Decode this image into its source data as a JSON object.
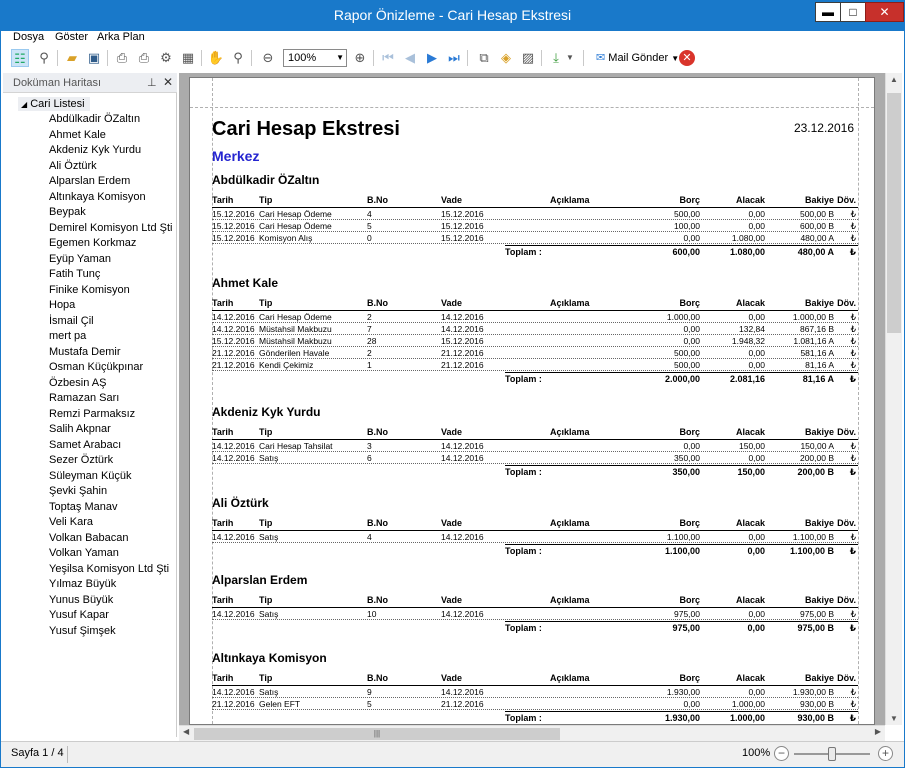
{
  "window": {
    "title": "Rapor Önizleme - Cari Hesap Ekstresi"
  },
  "menu": [
    "Dosya",
    "Göster",
    "Arka Plan"
  ],
  "toolbar": {
    "zoom_value": "100%",
    "mail_label": "Mail Gönder"
  },
  "sidebar": {
    "title": "Doküman Haritası",
    "root": "Cari Listesi",
    "items": [
      "Abdülkadir ÖZaltın",
      "Ahmet Kale",
      "Akdeniz Kyk Yurdu",
      "Ali Öztürk",
      "Alparslan Erdem",
      "Altınkaya Komisyon",
      "Beypak",
      "Demirel Komisyon Ltd Şti",
      "Egemen Korkmaz",
      "Eyüp Yaman",
      "Fatih Tunç",
      "Finike Komisyon",
      "Hopa",
      "İsmail Çil",
      "mert pa",
      "Mustafa Demir",
      "Osman Küçükpınar",
      "Özbesin AŞ",
      "Ramazan Sarı",
      "Remzi Parmaksız",
      "Salih Akpnar",
      "Samet Arabacı",
      "Sezer Öztürk",
      "Süleyman Küçük",
      "Şevki Şahin",
      "Toptaş Manav",
      "Veli Kara",
      "Volkan Babacan",
      "Volkan Yaman",
      "Yeşilsa Komisyon Ltd Şti",
      "Yılmaz Büyük",
      "Yunus Büyük",
      "Yusuf Kapar",
      "Yusuf Şimşek"
    ]
  },
  "report": {
    "title": "Cari Hesap Ekstresi",
    "date": "23.12.2016",
    "branch": "Merkez",
    "columns": {
      "tarih": "Tarih",
      "tip": "Tip",
      "bno": "B.No",
      "vade": "Vade",
      "aciklama": "Açıklama",
      "borc": "Borç",
      "alacak": "Alacak",
      "bakiye": "Bakiye",
      "dov": "Döv."
    },
    "total_label": "Toplam  :",
    "customers": [
      {
        "name": "Abdülkadir ÖZaltın",
        "rows": [
          [
            "15.12.2016",
            "Cari Hesap Ödeme",
            "4",
            "15.12.2016",
            "",
            "500,00",
            "0,00",
            "500,00 B",
            "₺"
          ],
          [
            "15.12.2016",
            "Cari Hesap Ödeme",
            "5",
            "15.12.2016",
            "",
            "100,00",
            "0,00",
            "600,00 B",
            "₺"
          ],
          [
            "15.12.2016",
            "Komisyon Alış",
            "0",
            "15.12.2016",
            "",
            "0,00",
            "1.080,00",
            "480,00 A",
            "₺"
          ]
        ],
        "total": [
          "600,00",
          "1.080,00",
          "480,00 A",
          "₺"
        ]
      },
      {
        "name": "Ahmet Kale",
        "rows": [
          [
            "14.12.2016",
            "Cari Hesap Ödeme",
            "2",
            "14.12.2016",
            "",
            "1.000,00",
            "0,00",
            "1.000,00 B",
            "₺"
          ],
          [
            "14.12.2016",
            "Müstahsil Makbuzu",
            "7",
            "14.12.2016",
            "",
            "0,00",
            "132,84",
            "867,16 B",
            "₺"
          ],
          [
            "15.12.2016",
            "Müstahsil Makbuzu",
            "28",
            "15.12.2016",
            "",
            "0,00",
            "1.948,32",
            "1.081,16 A",
            "₺"
          ],
          [
            "21.12.2016",
            "Gönderilen Havale",
            "2",
            "21.12.2016",
            "",
            "500,00",
            "0,00",
            "581,16 A",
            "₺"
          ],
          [
            "21.12.2016",
            "Kendi Çekimiz",
            "1",
            "21.12.2016",
            "",
            "500,00",
            "0,00",
            "81,16 A",
            "₺"
          ]
        ],
        "total": [
          "2.000,00",
          "2.081,16",
          "81,16 A",
          "₺"
        ]
      },
      {
        "name": "Akdeniz Kyk Yurdu",
        "rows": [
          [
            "14.12.2016",
            "Cari Hesap Tahsilat",
            "3",
            "14.12.2016",
            "",
            "0,00",
            "150,00",
            "150,00 A",
            "₺"
          ],
          [
            "14.12.2016",
            "Satış",
            "6",
            "14.12.2016",
            "",
            "350,00",
            "0,00",
            "200,00 B",
            "₺"
          ]
        ],
        "total": [
          "350,00",
          "150,00",
          "200,00 B",
          "₺"
        ]
      },
      {
        "name": "Ali Öztürk",
        "rows": [
          [
            "14.12.2016",
            "Satış",
            "4",
            "14.12.2016",
            "",
            "1.100,00",
            "0,00",
            "1.100,00 B",
            "₺"
          ]
        ],
        "total": [
          "1.100,00",
          "0,00",
          "1.100,00 B",
          "₺"
        ]
      },
      {
        "name": "Alparslan Erdem",
        "rows": [
          [
            "14.12.2016",
            "Satış",
            "10",
            "14.12.2016",
            "",
            "975,00",
            "0,00",
            "975,00 B",
            "₺"
          ]
        ],
        "total": [
          "975,00",
          "0,00",
          "975,00 B",
          "₺"
        ]
      },
      {
        "name": "Altınkaya Komisyon",
        "rows": [
          [
            "14.12.2016",
            "Satış",
            "9",
            "14.12.2016",
            "",
            "1.930,00",
            "0,00",
            "1.930,00 B",
            "₺"
          ],
          [
            "21.12.2016",
            "Gelen EFT",
            "5",
            "21.12.2016",
            "",
            "0,00",
            "1.000,00",
            "930,00 B",
            "₺"
          ]
        ],
        "total": [
          "1.930,00",
          "1.000,00",
          "930,00 B",
          "₺"
        ]
      }
    ]
  },
  "status": {
    "page": "Sayfa 1 / 4",
    "zoom": "100%"
  }
}
